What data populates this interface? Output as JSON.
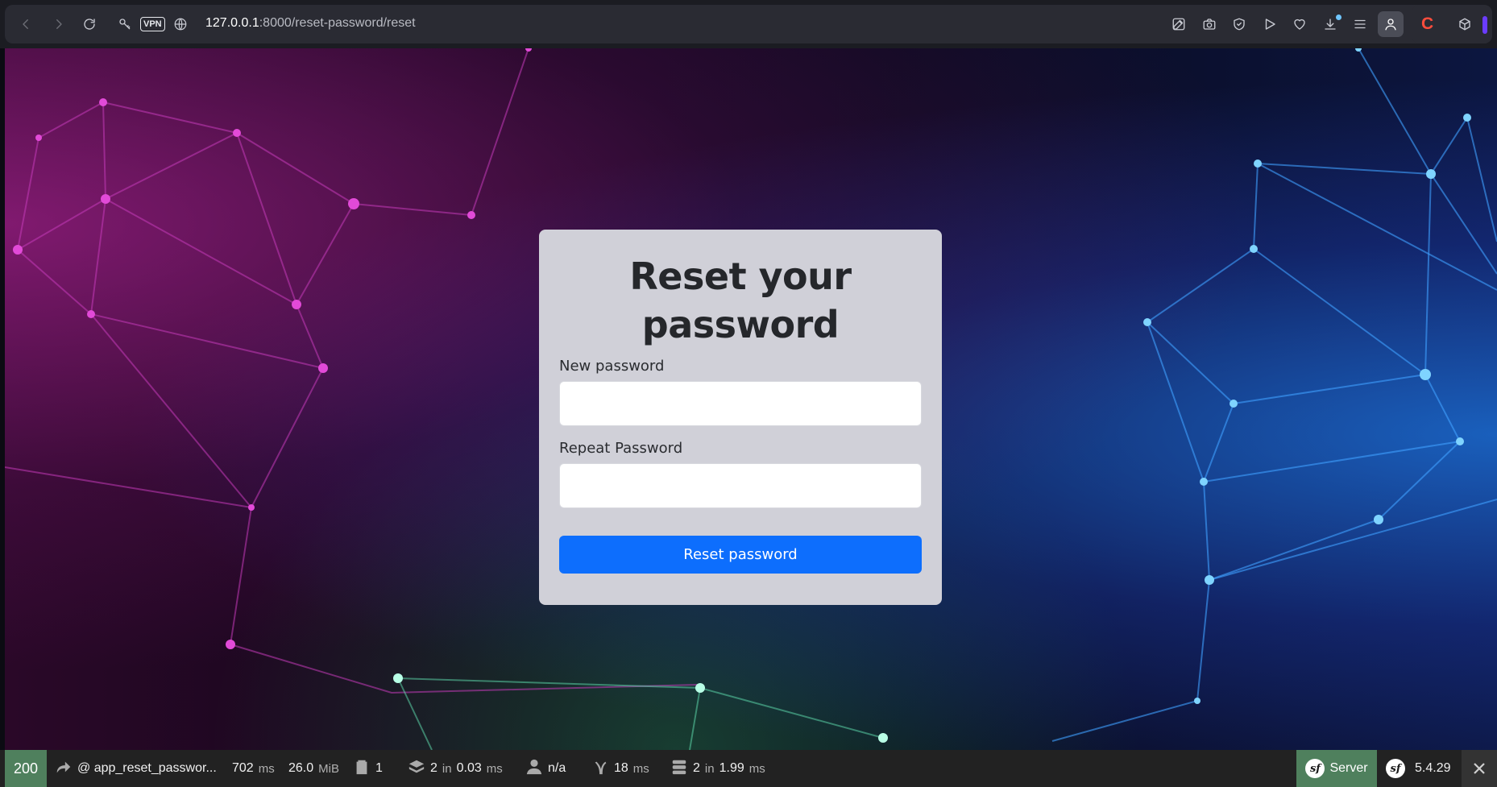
{
  "browser": {
    "vpn_label": "VPN",
    "url_host": "127.0.0.1",
    "url_path": ":8000/reset-password/reset",
    "ext_label": "C"
  },
  "page": {
    "title": "Reset your password",
    "fields": [
      {
        "label": "New password",
        "value": ""
      },
      {
        "label": "Repeat Password",
        "value": ""
      }
    ],
    "submit_label": "Reset password",
    "colors": {
      "card_bg": "#d0d0d8",
      "button_bg": "#0d6efd"
    }
  },
  "debug_toolbar": {
    "status_code": "200",
    "route": "@ app_reset_passwor...",
    "time_value": "702",
    "time_unit": "ms",
    "memory_value": "26.0",
    "memory_unit": "MiB",
    "logs_count": "1",
    "cache_count": "2",
    "cache_in": "in",
    "cache_time": "0.03",
    "cache_unit": "ms",
    "user": "n/a",
    "twig_time": "18",
    "twig_unit": "ms",
    "db_count": "2",
    "db_in": "in",
    "db_time": "1.99",
    "db_unit": "ms",
    "server_label": "Server",
    "version": "5.4.29",
    "status_color": "#4f805d"
  }
}
